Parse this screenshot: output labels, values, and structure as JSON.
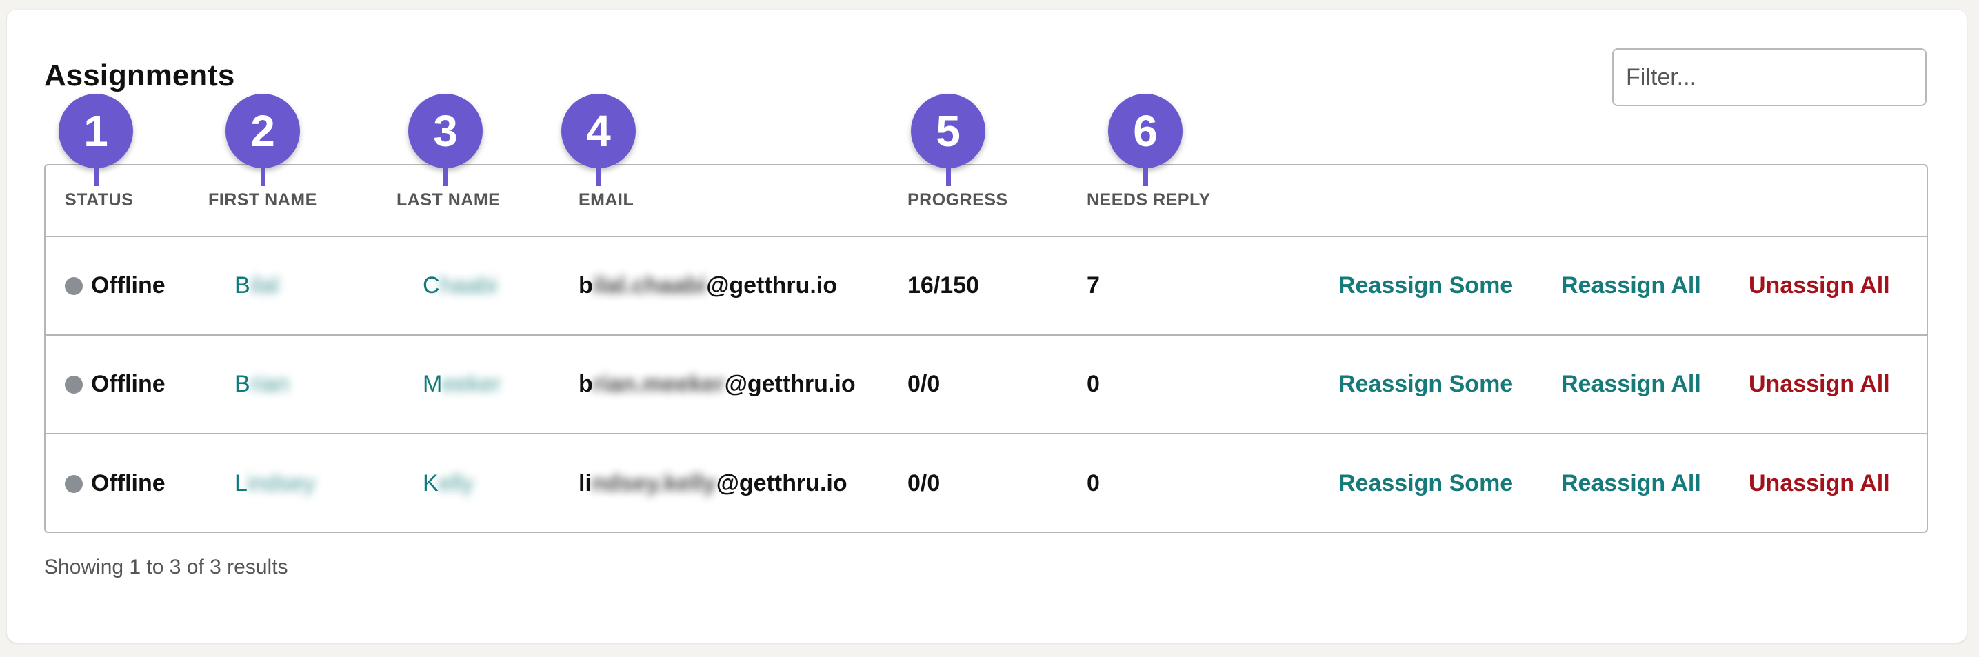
{
  "page": {
    "title": "Assignments"
  },
  "filter": {
    "placeholder": "Filter..."
  },
  "columns": [
    "STATUS",
    "FIRST NAME",
    "LAST NAME",
    "EMAIL",
    "PROGRESS",
    "NEEDS REPLY"
  ],
  "markers": [
    "1",
    "2",
    "3",
    "4",
    "5",
    "6"
  ],
  "rows": [
    {
      "status": "Offline",
      "first_visible": "B",
      "first_hidden": "ilal",
      "last_visible": "C",
      "last_hidden": "haabi",
      "email_prefix": "b",
      "email_hidden": "ilal.chaabi",
      "email_domain": "@getthru.io",
      "progress": "16/150",
      "needs_reply": "7"
    },
    {
      "status": "Offline",
      "first_visible": "B",
      "first_hidden": "rian",
      "last_visible": "M",
      "last_hidden": "eeker",
      "email_prefix": "b",
      "email_hidden": "rian.meeker",
      "email_domain": "@getthru.io",
      "progress": "0/0",
      "needs_reply": "0"
    },
    {
      "status": "Offline",
      "first_visible": "L",
      "first_hidden": "indsey",
      "last_visible": "K",
      "last_hidden": "elly",
      "email_prefix": "li",
      "email_hidden": "ndsey.kelly",
      "email_domain": "@getthru.io",
      "progress": "0/0",
      "needs_reply": "0"
    }
  ],
  "actions": {
    "reassign_some": "Reassign Some",
    "reassign_all": "Reassign All",
    "unassign_all": "Unassign All"
  },
  "footer": {
    "text": "Showing 1 to 3 of 3 results"
  },
  "colors": {
    "accent": "#16797a",
    "danger": "#a3111b",
    "marker": "#6a58cf",
    "status_offline": "#8a8f96"
  }
}
